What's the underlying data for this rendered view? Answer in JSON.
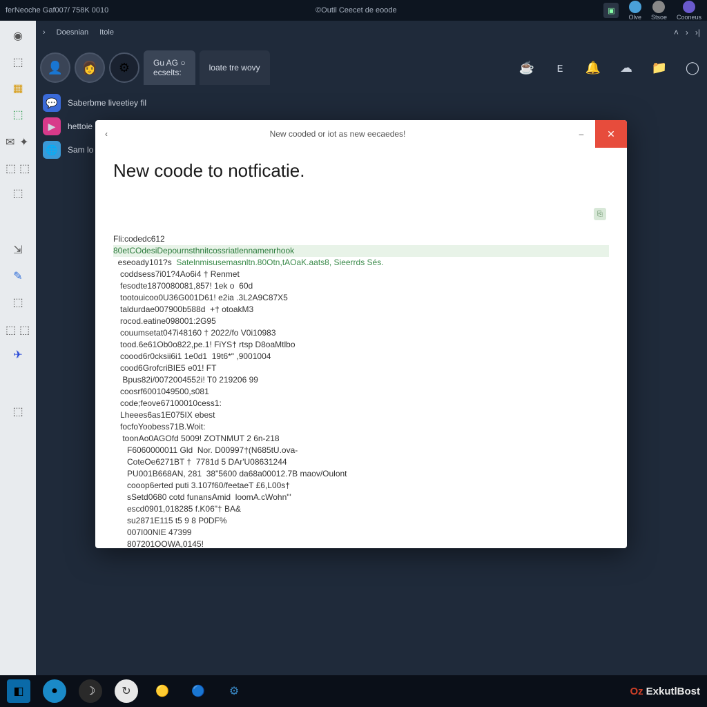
{
  "titlebar": {
    "left": "ferNeoche Gaf007/ 758K 0010",
    "center": "©Outil Ceecet de eoode",
    "icons": [
      {
        "label": "",
        "glyph": "▣",
        "bg": "#2a3544"
      },
      {
        "label": "Olve",
        "dot": "#4aa0d8"
      },
      {
        "label": "Stsoe",
        "dot": "#888"
      },
      {
        "label": "Cooneus",
        "dot": "#6a5acd"
      }
    ]
  },
  "subbar": {
    "tabs": [
      "Doesnian",
      "Itole"
    ],
    "arrow": "›"
  },
  "identity": {
    "avatars": [
      "👤",
      "👩",
      "⚙"
    ],
    "tab_active": {
      "line1": "Gu AG ○",
      "line2": "ecselts:"
    },
    "tab_alt": {
      "line1": "loate tre wovy"
    },
    "tools": [
      "☕",
      "ᴇ",
      "🔔",
      "☁",
      "📁",
      "◯"
    ]
  },
  "channels": [
    {
      "icon_bg": "#3a6ad8",
      "glyph": "💬",
      "label": "Saberbme liveetiey fil"
    },
    {
      "icon_bg": "#d83a8a",
      "glyph": "▶",
      "label": "hettoie"
    },
    {
      "icon_bg": "#3a9ad8",
      "glyph": "🌐",
      "label": "Sam lo"
    }
  ],
  "modal": {
    "back": "‹",
    "title": "New cooded or iot as new eecaedes!",
    "min": "–",
    "close": "✕",
    "heading": "New coode to notficatie.",
    "copy_glyph": "⎘",
    "code_lines": [
      {
        "t": "Fli:codedc612",
        "cls": ""
      },
      {
        "t": "80etCOdesiDepournsthnitcossriatlennamenrhook",
        "cls": "hl"
      },
      {
        "t": "  eseoady101?s  ",
        "tail": "Satelnmisusemasnltn.80Otn,tAOaK.aats8, Sieerrds Sés.",
        "cls": "green"
      },
      {
        "t": "   coddsess7i01?4Ao6i4 † Renmet",
        "cls": ""
      },
      {
        "t": "   fesodte1870080081,857! 1ek o  60d",
        "cls": ""
      },
      {
        "t": "   tootouicoo0U36G001D61! e2ia .3L2A9C87X5",
        "cls": ""
      },
      {
        "t": "   taldurdae007900b588d  +† otoakM3",
        "cls": ""
      },
      {
        "t": "   rocod.eatine098001:2G95",
        "cls": ""
      },
      {
        "t": "   couumsetat047i48160 † 2022/fo V0i10983",
        "cls": ""
      },
      {
        "t": "   tood.6e61Ob0o822,pe.1! FiYS† rtsp D8oaMtlbo",
        "cls": ""
      },
      {
        "t": "   coood6r0cksii6i1 1e0d1  19t6*\" ,9001004",
        "cls": ""
      },
      {
        "t": "   cood6GrofcriBIE5 e01! FT",
        "cls": ""
      },
      {
        "t": "    Bpus82i/0072004552i! T0 219206 99",
        "cls": ""
      },
      {
        "t": "   coosrf6001049500,s081",
        "cls": ""
      },
      {
        "t": "   code;feove67100010cess1:",
        "cls": ""
      },
      {
        "t": "   Lheees6as1E075IX ebest",
        "cls": ""
      },
      {
        "t": "   focfoYoobess71B.Woit:",
        "cls": ""
      },
      {
        "t": "    toonAo0AGOfd 5009! ZOTNMUT 2 6n-218",
        "cls": ""
      },
      {
        "t": "      F6060000011 Gld  Nor. D00997†(N685tU.ova-",
        "cls": ""
      },
      {
        "t": "      CoteOe6271BT †  7781d 5 DAr'U08631244",
        "cls": ""
      },
      {
        "t": "      PU001B668AN, 281  38\"5600 da68a00012.7B maov/Oulont",
        "cls": ""
      },
      {
        "t": "      cooop6erted puti 3.107f60/feetaeT £6,L00s†",
        "cls": ""
      },
      {
        "t": "      sSetd0680 cotd funansAmid  loomA.cWohn\"'",
        "cls": ""
      },
      {
        "t": "      escd0901,018285 f.K06\"† BA&",
        "cls": ""
      },
      {
        "t": "      su2871E115 t5 9 8 P0DF%",
        "cls": ""
      },
      {
        "t": "      007I00NIE 47399",
        "cls": ""
      },
      {
        "t": "      807201OOWA,0145!",
        "cls": ""
      },
      {
        "t": "     |",
        "cls": ""
      },
      {
        "t": "",
        "cls": ""
      },
      {
        "t": "   }\"",
        "cls": ""
      },
      {
        "t": " ]\"",
        "cls": ""
      }
    ]
  },
  "rail_icons": [
    "◉",
    "⬚",
    "▦",
    "⬚",
    "✉",
    "✦",
    "⬚",
    "⬚",
    "⬚",
    "⇲",
    "✎",
    "⬚",
    "⬚",
    "✈",
    "⬚"
  ],
  "taskbar": {
    "items": [
      {
        "bg": "#0a6aa8",
        "glyph": "◧"
      },
      {
        "bg": "#1a8ac8",
        "glyph": "●"
      },
      {
        "bg": "#2a2a2a",
        "glyph": "☽"
      },
      {
        "bg": "#e8e8e8",
        "glyph": "↻"
      },
      {
        "bg": "#transparent",
        "glyph": "🟡"
      },
      {
        "bg": "#transparent",
        "glyph": "🔵"
      },
      {
        "bg": "#transparent",
        "glyph": "⚙"
      }
    ],
    "brand_prefix": "Oz",
    "brand": "ExkutlBost"
  }
}
